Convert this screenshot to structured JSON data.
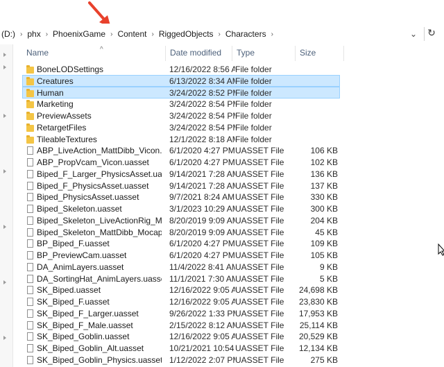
{
  "breadcrumb": {
    "items": [
      "(D:)",
      "phx",
      "PhoenixGame",
      "Content",
      "RiggedObjects",
      "Characters"
    ],
    "separator": "›"
  },
  "address": {
    "dropdown_icon": "chevron-down-icon",
    "refresh_icon": "refresh-icon"
  },
  "columns": {
    "name": "Name",
    "date": "Date modified",
    "type": "Type",
    "size": "Size"
  },
  "colors": {
    "selection": "#cce8ff",
    "selection_border": "#99d1ff",
    "arrow": "#e8412c",
    "folder": "#f4c545"
  },
  "files": [
    {
      "name": "BoneLODSettings",
      "date": "12/16/2022 8:56 AM",
      "type": "File folder",
      "size": "",
      "kind": "folder",
      "selected": false
    },
    {
      "name": "Creatures",
      "date": "6/13/2022 8:34 AM",
      "type": "File folder",
      "size": "",
      "kind": "folder",
      "selected": true
    },
    {
      "name": "Human",
      "date": "3/24/2022 8:52 PM",
      "type": "File folder",
      "size": "",
      "kind": "folder",
      "selected": true
    },
    {
      "name": "Marketing",
      "date": "3/24/2022 8:54 PM",
      "type": "File folder",
      "size": "",
      "kind": "folder",
      "selected": false
    },
    {
      "name": "PreviewAssets",
      "date": "3/24/2022 8:54 PM",
      "type": "File folder",
      "size": "",
      "kind": "folder",
      "selected": false
    },
    {
      "name": "RetargetFiles",
      "date": "3/24/2022 8:54 PM",
      "type": "File folder",
      "size": "",
      "kind": "folder",
      "selected": false
    },
    {
      "name": "TileableTextures",
      "date": "12/1/2022 8:18 AM",
      "type": "File folder",
      "size": "",
      "kind": "folder",
      "selected": false
    },
    {
      "name": "ABP_LiveAction_MattDibb_Vicon.uasset",
      "date": "6/1/2020 4:27 PM",
      "type": "UASSET File",
      "size": "106 KB",
      "kind": "file",
      "selected": false
    },
    {
      "name": "ABP_PropVcam_Vicon.uasset",
      "date": "6/1/2020 4:27 PM",
      "type": "UASSET File",
      "size": "102 KB",
      "kind": "file",
      "selected": false
    },
    {
      "name": "Biped_F_Larger_PhysicsAsset.uasset",
      "date": "9/14/2021 7:28 AM",
      "type": "UASSET File",
      "size": "136 KB",
      "kind": "file",
      "selected": false
    },
    {
      "name": "Biped_F_PhysicsAsset.uasset",
      "date": "9/14/2021 7:28 AM",
      "type": "UASSET File",
      "size": "137 KB",
      "kind": "file",
      "selected": false
    },
    {
      "name": "Biped_PhysicsAsset.uasset",
      "date": "9/7/2021 8:24 AM",
      "type": "UASSET File",
      "size": "330 KB",
      "kind": "file",
      "selected": false
    },
    {
      "name": "Biped_Skeleton.uasset",
      "date": "3/1/2023 10:29 AM",
      "type": "UASSET File",
      "size": "300 KB",
      "kind": "file",
      "selected": false
    },
    {
      "name": "Biped_Skeleton_LiveActionRig_MattDibb...",
      "date": "8/20/2019 9:09 AM",
      "type": "UASSET File",
      "size": "204 KB",
      "kind": "file",
      "selected": false
    },
    {
      "name": "Biped_Skeleton_MattDibb_MocapActor.u...",
      "date": "8/20/2019 9:09 AM",
      "type": "UASSET File",
      "size": "45 KB",
      "kind": "file",
      "selected": false
    },
    {
      "name": "BP_Biped_F.uasset",
      "date": "6/1/2020 4:27 PM",
      "type": "UASSET File",
      "size": "109 KB",
      "kind": "file",
      "selected": false
    },
    {
      "name": "BP_PreviewCam.uasset",
      "date": "6/1/2020 4:27 PM",
      "type": "UASSET File",
      "size": "105 KB",
      "kind": "file",
      "selected": false
    },
    {
      "name": "DA_AnimLayers.uasset",
      "date": "11/4/2022 8:41 AM",
      "type": "UASSET File",
      "size": "9 KB",
      "kind": "file",
      "selected": false
    },
    {
      "name": "DA_SortingHat_AnimLayers.uasset",
      "date": "11/1/2021 7:30 AM",
      "type": "UASSET File",
      "size": "5 KB",
      "kind": "file",
      "selected": false
    },
    {
      "name": "SK_Biped.uasset",
      "date": "12/16/2022 9:05 AM",
      "type": "UASSET File",
      "size": "24,698 KB",
      "kind": "file",
      "selected": false
    },
    {
      "name": "SK_Biped_F.uasset",
      "date": "12/16/2022 9:05 AM",
      "type": "UASSET File",
      "size": "23,830 KB",
      "kind": "file",
      "selected": false
    },
    {
      "name": "SK_Biped_F_Larger.uasset",
      "date": "9/26/2022 1:33 PM",
      "type": "UASSET File",
      "size": "17,953 KB",
      "kind": "file",
      "selected": false
    },
    {
      "name": "SK_Biped_F_Male.uasset",
      "date": "2/15/2022 8:12 AM",
      "type": "UASSET File",
      "size": "25,114 KB",
      "kind": "file",
      "selected": false
    },
    {
      "name": "SK_Biped_Goblin.uasset",
      "date": "12/16/2022 9:05 AM",
      "type": "UASSET File",
      "size": "20,529 KB",
      "kind": "file",
      "selected": false
    },
    {
      "name": "SK_Biped_Goblin_Alt.uasset",
      "date": "10/21/2021 10:54 ...",
      "type": "UASSET File",
      "size": "12,134 KB",
      "kind": "file",
      "selected": false
    },
    {
      "name": "SK_Biped_Goblin_Physics.uasset",
      "date": "1/12/2022 2:07 PM",
      "type": "UASSET File",
      "size": "275 KB",
      "kind": "file",
      "selected": false
    }
  ]
}
